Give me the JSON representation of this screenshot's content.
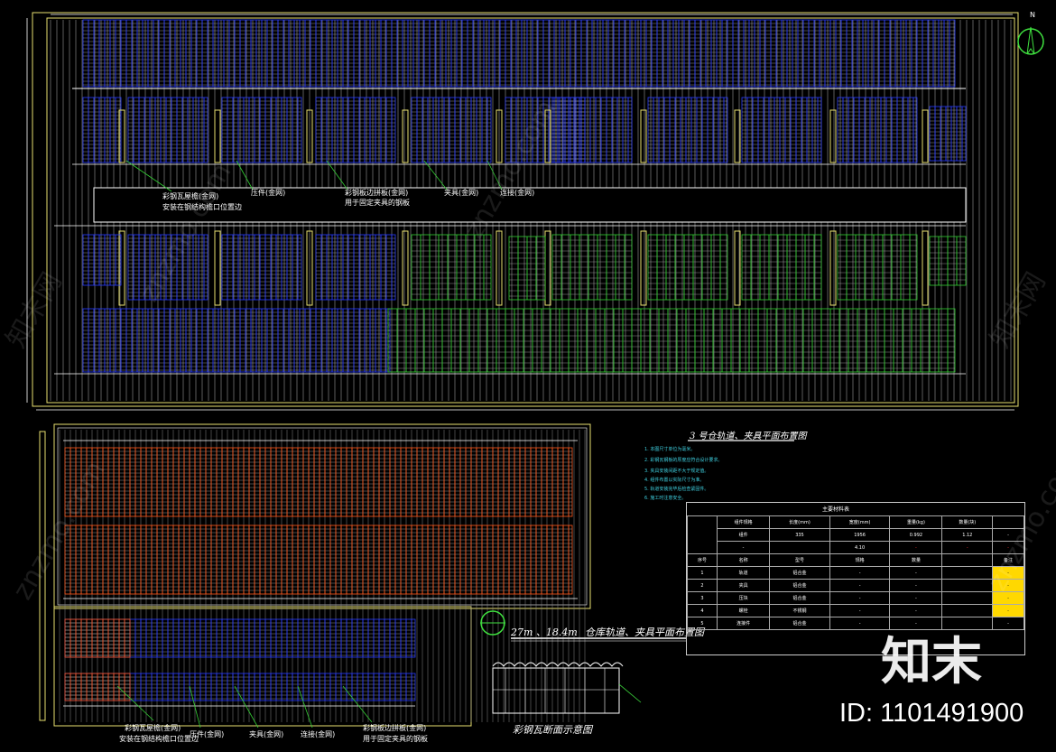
{
  "colors": {
    "background": "#000000",
    "frame": "#e8e070",
    "blue_panels": "#2a3cff",
    "green_panels": "#33cc33",
    "orange_panels": "#ff5a1e",
    "grid_lines": "#b0b0b0",
    "notes": "#3fd0e0",
    "yellow_highlight": "#ffd800",
    "red_highlight": "#ff3030"
  },
  "top_plan": {
    "annotations": [
      "彩钢瓦屋檐(金网)",
      "安装在钢结构檐口位置边",
      "压件(金网)",
      "彩钢板边拼板(金网)",
      "用于固定夹具的钢板",
      "夹具(金网)",
      "连接(金网)"
    ]
  },
  "section_title": "3 号仓轨道、夹具平面布置图",
  "notes": [
    "1. 本图尺寸单位为毫米。",
    "2. 彩钢瓦钢板的厚度应符合设计要求。",
    "3. 夹具安装间距不大于规定值。",
    "4. 组件布置以实际尺寸为准。",
    "5. 轨道安装完毕后检查紧固件。",
    "6. 施工时注意安全。"
  ],
  "table": {
    "title": "主要材料表",
    "header_row": [
      "组件规格",
      "长度(mm)",
      "宽度(mm)",
      "重量(kg)",
      "数量(块)"
    ],
    "row1": [
      "组件",
      "335",
      "1956",
      "0.992",
      "1.12",
      "-"
    ],
    "row2": [
      "-",
      "4.10",
      "-",
      "-",
      "-"
    ],
    "col_headers": [
      "序号",
      "名称",
      "型号",
      "规格",
      "数量",
      "备注"
    ],
    "rows": [
      [
        "1",
        "轨道",
        "铝合金",
        "-",
        "-",
        "-"
      ],
      [
        "2",
        "夹具",
        "铝合金",
        "-",
        "-",
        "-"
      ],
      [
        "3",
        "压块",
        "铝合金",
        "-",
        "-",
        "-"
      ],
      [
        "4",
        "螺栓",
        "不锈钢",
        "-",
        "-",
        "-"
      ],
      [
        "5",
        "连接件",
        "铝合金",
        "-",
        "-",
        "-"
      ]
    ]
  },
  "bottom_plan_title_numbers": "27m  、18.4m",
  "bottom_plan_title_text": "仓库轨道、夹具平面布置图",
  "section_diagram_title": "彩钢瓦断面示意图",
  "bottom_annotations": [
    "彩钢瓦屋檐(金网)",
    "安装在钢结构檐口位置边",
    "压件(金网)",
    "夹具(金网)",
    "连接(金网)",
    "彩钢板边拼板(金网)",
    "用于固定夹具的钢板"
  ],
  "north_symbol": "N",
  "brand_chinese": "知末",
  "brand_id": "ID: 1101491900",
  "watermarks": [
    "知末网",
    "znzmo.com"
  ]
}
